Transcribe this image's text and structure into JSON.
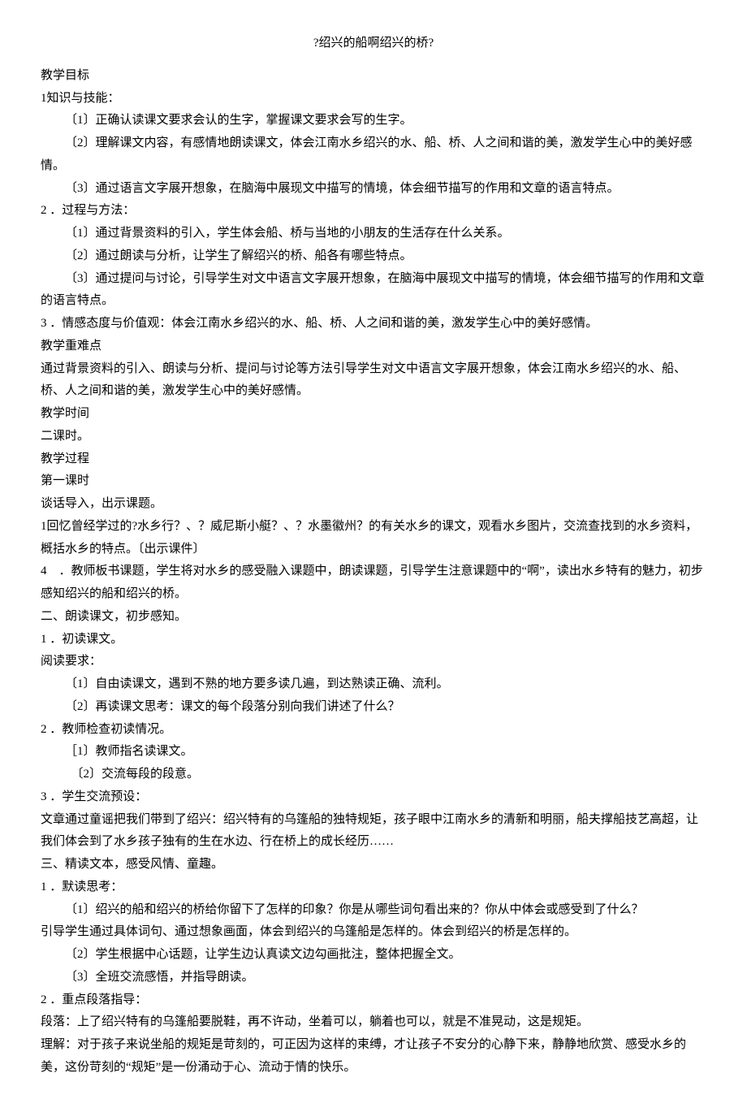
{
  "title": "?绍兴的船啊绍兴的桥?",
  "lines": [
    {
      "text": "教学目标",
      "cls": "para"
    },
    {
      "text": "1知识与技能：",
      "cls": "para"
    },
    {
      "text": "〔1〕正确认读课文要求会认的生字，掌握课文要求会写的生字。",
      "cls": "para indent"
    },
    {
      "text": "〔2〕理解课文内容，有感情地朗读课文，体会江南水乡绍兴的水、船、桥、人之间和谐的美，激发学生心中的美好感情。",
      "cls": "para indent"
    },
    {
      "text": "〔3〕通过语言文字展开想象，在脑海中展现文中描写的情境，体会细节描写的作用和文章的语言特点。",
      "cls": "para indent"
    },
    {
      "text": "2 ．过程与方法：",
      "cls": "para"
    },
    {
      "text": "〔1〕通过背景资料的引入，学生体会船、桥与当地的小朋友的生活存在什么关系。",
      "cls": "para indent"
    },
    {
      "text": "〔2〕通过朗读与分析，让学生了解绍兴的桥、船各有哪些特点。",
      "cls": "para indent"
    },
    {
      "text": "〔3〕通过提问与讨论，引导学生对文中语言文字展开想象，在脑海中展现文中描写的情境，体会细节描写的作用和文章的语言特点。",
      "cls": "para indent"
    },
    {
      "text": "3 ．情感态度与价值观：体会江南水乡绍兴的水、船、桥、人之间和谐的美，激发学生心中的美好感情。",
      "cls": "para"
    },
    {
      "text": "教学重难点",
      "cls": "para"
    },
    {
      "text": "通过背景资料的引入、朗读与分析、提问与讨论等方法引导学生对文中语言文字展开想象，体会江南水乡绍兴的水、船、桥、人之间和谐的美，激发学生心中的美好感情。",
      "cls": "para"
    },
    {
      "text": "教学时间",
      "cls": "para"
    },
    {
      "text": "二课时。",
      "cls": "para"
    },
    {
      "text": "教学过程",
      "cls": "para"
    },
    {
      "text": "第一课时",
      "cls": "para"
    },
    {
      "text": "谈话导入，出示课题。",
      "cls": "para"
    },
    {
      "text": "1回忆曾经学过的?水乡行？、？威尼斯小艇？、？水墨徽州？的有关水乡的课文，观看水乡图片，交流查找到的水乡资料，概括水乡的特点。〔出示课件〕",
      "cls": "para"
    },
    {
      "text": "4　．教师板书课题，学生将对水乡的感受融入课题中，朗读课题，引导学生注意课题中的“啊”，读出水乡特有的魅力，初步感知绍兴的船和绍兴的桥。",
      "cls": "para"
    },
    {
      "text": "二、朗读课文，初步感知。",
      "cls": "para"
    },
    {
      "text": "1 ．初读课文。",
      "cls": "para"
    },
    {
      "text": "阅读要求：",
      "cls": "para"
    },
    {
      "text": "〔1〕自由读课文，遇到不熟的地方要多读几遍，到达熟读正确、流利。",
      "cls": "para indent"
    },
    {
      "text": "〔2〕再读课文思考：课文的每个段落分别向我们讲述了什么？",
      "cls": "para indent"
    },
    {
      "text": "2 ．教师检查初读情况。",
      "cls": "para"
    },
    {
      "text": "［1〕教师指名读课文。",
      "cls": "para indent"
    },
    {
      "text": "〔2〕交流每段的段意。",
      "cls": "para indent-deep"
    },
    {
      "text": "3 ．学生交流预设：",
      "cls": "para"
    },
    {
      "text": "文章通过童谣把我们带到了绍兴：绍兴特有的乌篷船的独特规矩，孩子眼中江南水乡的清新和明丽，船夫撑船技艺高超，让我们体会到了水乡孩子独有的生在水边、行在桥上的成长经历……",
      "cls": "para"
    },
    {
      "text": "三、精读文本，感受风情、童趣。",
      "cls": "para"
    },
    {
      "text": "1 ．默读思考：",
      "cls": "para"
    },
    {
      "text": "〔1〕绍兴的船和绍兴的桥给你留下了怎样的印象？你是从哪些词句看出来的？你从中体会或感受到了什么？",
      "cls": "para indent"
    },
    {
      "text": "引导学生通过具体词句、通过想象画面，体会到绍兴的乌篷船是怎样的。体会到绍兴的桥是怎样的。",
      "cls": "para"
    },
    {
      "text": "〔2〕学生根据中心话题，让学生边认真读文边勾画批注，整体把握全文。",
      "cls": "para indent"
    },
    {
      "text": "〔3〕全班交流感悟，并指导朗读。",
      "cls": "para indent"
    },
    {
      "text": "2 ．重点段落指导：",
      "cls": "para"
    },
    {
      "text": "段落：上了绍兴特有的乌篷船要脱鞋，再不许动，坐着可以，躺着也可以，就是不准晃动，这是规矩。",
      "cls": "para"
    },
    {
      "text": "理解：对于孩子来说坐船的规矩是苛刻的，可正因为这样的束缚，才让孩子不安分的心静下来，静静地欣赏、感受水乡的美，这份苛刻的“规矩”是一份涌动于心、流动于情的快乐。",
      "cls": "para"
    }
  ]
}
